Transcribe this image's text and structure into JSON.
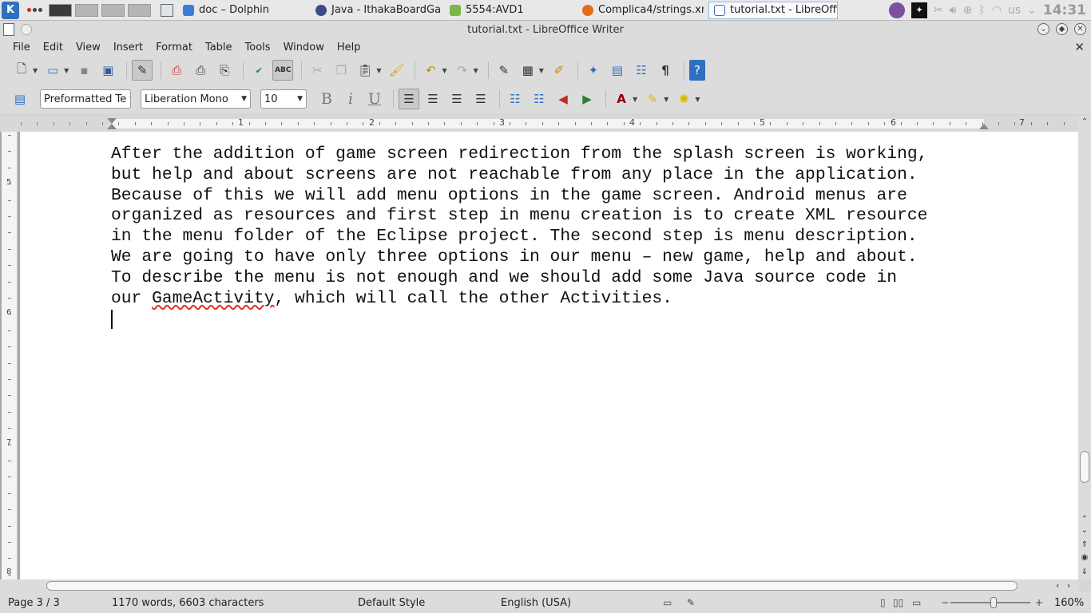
{
  "taskbar": {
    "tasks": [
      {
        "label": "doc – Dolphin",
        "color": "#3d7bd9"
      },
      {
        "label": "Java - IthakaBoardGam",
        "color": "#3a4a8a"
      },
      {
        "label": "5554:AVD1",
        "color": "#7ab648"
      },
      {
        "label": "Complica4/strings.xml",
        "color": "#e06c1e"
      },
      {
        "label": "tutorial.txt - LibreOffic",
        "color": "#3d6db6"
      }
    ],
    "keyboard_layout": "us",
    "clock": "14:31"
  },
  "window": {
    "title": "tutorial.txt - LibreOffice Writer"
  },
  "menu": [
    "File",
    "Edit",
    "View",
    "Insert",
    "Format",
    "Table",
    "Tools",
    "Window",
    "Help"
  ],
  "format_toolbar": {
    "paragraph_style": "Preformatted Te",
    "font_name": "Liberation Mono",
    "font_size": "10"
  },
  "ruler": {
    "numbers": [
      "1",
      "2",
      "3",
      "4",
      "5",
      "6",
      "7"
    ],
    "vertical_numbers": [
      "5",
      "6",
      "7",
      "8"
    ]
  },
  "document": {
    "lines": [
      "After the addition of game screen redirection from the splash screen is working,",
      "but help and about screens are not reachable from any place in the application.",
      "Because of this we will add menu options in the game screen. Android menus are",
      "organized as resources and first step in menu creation is to create XML resource",
      "in the menu folder of the Eclipse project. The second step is menu description.",
      "We are going to have only three options in our menu – new game, help and about.",
      "To describe the menu is not enough and we should add some Java source code in"
    ],
    "last_line_before": "our ",
    "last_line_misspelled": "GameActivity",
    "last_line_after": ", which will call the other Activities."
  },
  "status": {
    "page": "Page 3 / 3",
    "words": "1170 words, 6603 characters",
    "style": "Default Style",
    "language": "English (USA)",
    "zoom": "160%"
  }
}
